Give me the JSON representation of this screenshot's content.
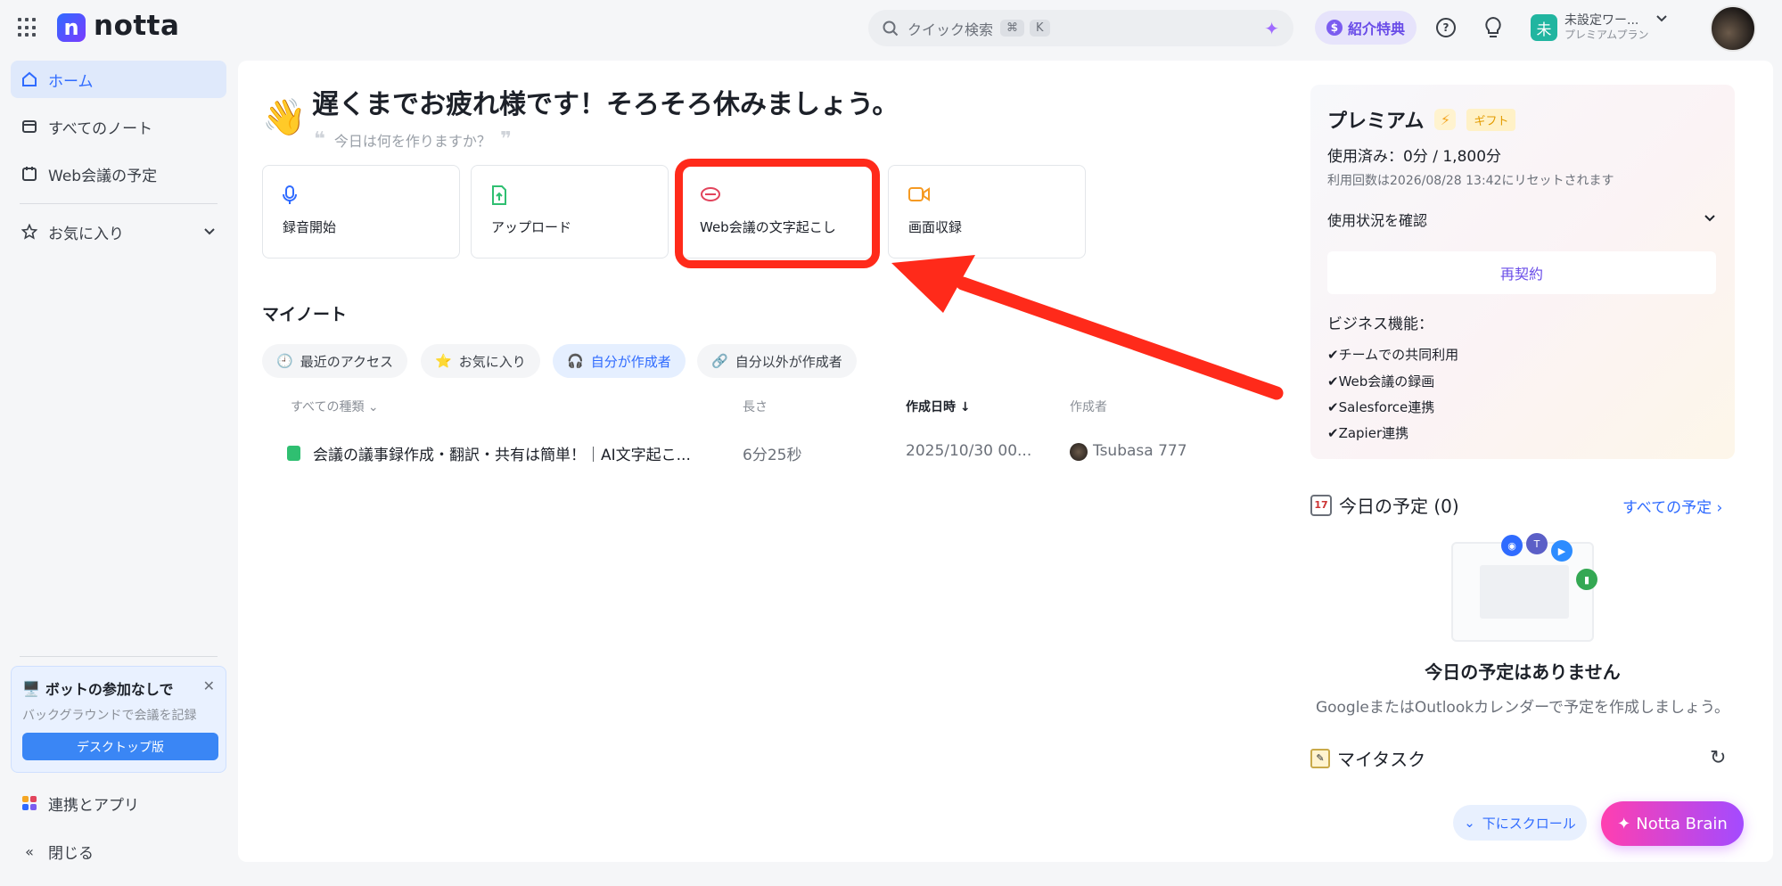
{
  "brand": {
    "logo_letter": "n",
    "name": "notta"
  },
  "search": {
    "placeholder": "クイック検索",
    "key1": "⌘",
    "key2": "K"
  },
  "header": {
    "referral_label": "紹介特典",
    "referral_icon": "dollar-coin-icon",
    "help_icon": "question-icon",
    "tips_icon": "lightbulb-icon",
    "workspace_badge": "未",
    "workspace_name": "未設定ワー...",
    "workspace_plan": "プレミアムプラン"
  },
  "sidebar": {
    "items": [
      {
        "label": "ホーム",
        "icon": "home-icon"
      },
      {
        "label": "すべてのノート",
        "icon": "folder-icon"
      },
      {
        "label": "Web会議の予定",
        "icon": "calendar-icon"
      },
      {
        "label": "お気に入り",
        "icon": "star-icon"
      }
    ],
    "bot_card": {
      "title": "ボットの参加なしで",
      "subtitle": "バックグラウンドで会議を記録",
      "button": "デスクトップ版"
    },
    "integrations": "連携とアプリ",
    "close": "閉じる"
  },
  "main": {
    "greeting": "遅くまでお疲れ様です！そろそろ休みましょう。",
    "prompt": "今日は何を作りますか？",
    "actions": [
      {
        "label": "録音開始",
        "icon": "microphone-icon",
        "color": "#2f6bff"
      },
      {
        "label": "アップロード",
        "icon": "upload-icon",
        "color": "#2fbf71"
      },
      {
        "label": "Web会議の文字起こし",
        "icon": "meeting-icon",
        "color": "#e2445c"
      },
      {
        "label": "画面収録",
        "icon": "video-icon",
        "color": "#f59a23"
      }
    ],
    "my_notes_title": "マイノート",
    "filters": [
      {
        "label": "最近のアクセス",
        "icon": "clock-icon"
      },
      {
        "label": "お気に入り",
        "icon": "star-icon"
      },
      {
        "label": "自分が作成者",
        "icon": "headphones-icon"
      },
      {
        "label": "自分以外が作成者",
        "icon": "link-icon"
      }
    ],
    "table": {
      "headers": [
        "すべての種類",
        "長さ",
        "作成日時",
        "作成者"
      ],
      "rows": [
        {
          "title": "会議の議事録作成・翻訳・共有は簡単！｜AI文字起こ...",
          "length": "6分25秒",
          "created": "2025/10/30 00...",
          "author": "Tsubasa 777"
        }
      ]
    }
  },
  "premium": {
    "title": "プレミアム",
    "gift": "ギフト",
    "used": "使用済み：0分 / 1,800分",
    "reset": "利用回数は2026/08/28 13:42にリセットされます",
    "check_usage": "使用状況を確認",
    "renew": "再契約",
    "biz_title": "ビジネス機能：",
    "biz_items": [
      "✔チームでの共同利用",
      "✔Web会議の録画",
      "✔Salesforce連携",
      "✔Zapier連携"
    ]
  },
  "schedule": {
    "title": "今日の予定 (0)",
    "calendar_day": "17",
    "all_link": "すべての予定",
    "empty_title": "今日の予定はありません",
    "empty_sub": "GoogleまたはOutlookカレンダーで予定を作成しましょう。"
  },
  "tasks": {
    "title": "マイタスク"
  },
  "floating": {
    "scroll_down": "下にスクロール",
    "brain": "Notta Brain"
  },
  "colors": {
    "accent": "#2f6bff",
    "highlight": "#ff2a1a",
    "brain_start": "#ff3fb0",
    "brain_end": "#a34bff"
  }
}
